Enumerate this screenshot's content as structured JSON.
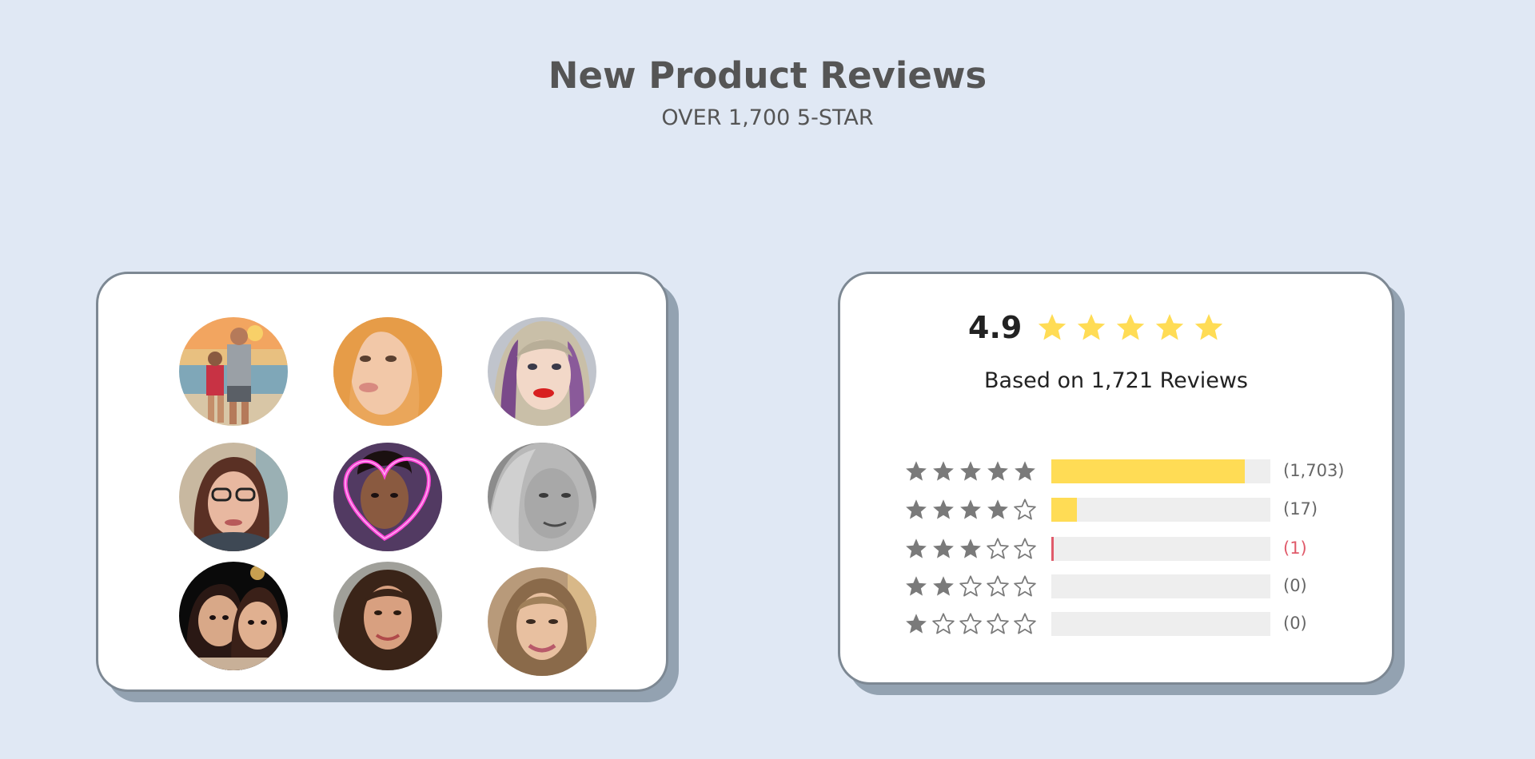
{
  "header": {
    "title": "New Product Reviews",
    "subtitle": "OVER 1,700 5-STAR"
  },
  "photos": [
    {
      "name": "reviewer-photo-beach-couple"
    },
    {
      "name": "reviewer-photo-blonde-selfie"
    },
    {
      "name": "reviewer-photo-silver-hair"
    },
    {
      "name": "reviewer-photo-glasses"
    },
    {
      "name": "reviewer-photo-heart-frame"
    },
    {
      "name": "reviewer-photo-grayscale"
    },
    {
      "name": "reviewer-photo-two-women"
    },
    {
      "name": "reviewer-photo-curly-hair"
    },
    {
      "name": "reviewer-photo-smiling-woman"
    }
  ],
  "summary": {
    "rating": "4.9",
    "rating_stars": 5,
    "based_on": "Based on 1,721 Reviews",
    "distribution": [
      {
        "stars": 5,
        "count": "(1,703)",
        "fraction": 0.885
      },
      {
        "stars": 4,
        "count": "(17)",
        "fraction": 0.115
      },
      {
        "stars": 3,
        "count": "(1)",
        "fraction": 0.01
      },
      {
        "stars": 2,
        "count": "(0)",
        "fraction": 0
      },
      {
        "stars": 1,
        "count": "(0)",
        "fraction": 0
      }
    ]
  },
  "colors": {
    "background": "#e0e8f4",
    "star_gold": "#ffdc55",
    "star_gray": "#7a7a7a",
    "bar_track": "#eeeeee",
    "low_count": "#e05a6a"
  }
}
